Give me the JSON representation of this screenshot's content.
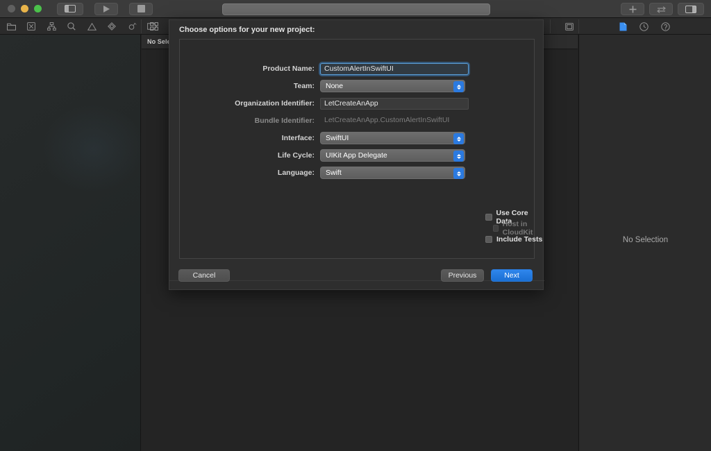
{
  "window": {
    "traffic_lights": [
      "close",
      "minimize",
      "zoom"
    ],
    "toolbar_left_buttons": [
      "toggle-navigator",
      "run",
      "stop"
    ],
    "toolbar_right_buttons": [
      "add-editor",
      "swap-editor",
      "toggle-inspector"
    ],
    "location_bar_value": ""
  },
  "navigator": {
    "tabs": [
      "folder-icon",
      "issue-icon",
      "test-icon",
      "search-icon",
      "warning-icon",
      "breakpoint-icon",
      "debug-icon",
      "tag-icon",
      "report-icon"
    ],
    "right_tabs": [
      "grid-icon",
      "chevron-left-icon"
    ]
  },
  "editor": {
    "jump_bar_label": "No Selec",
    "assistant_icon": "assistant-editor-icon"
  },
  "inspector": {
    "tabs": [
      "file-inspector-icon",
      "history-inspector-icon",
      "quick-help-icon"
    ],
    "active_tab": "file-inspector-icon",
    "empty_text": "No Selection",
    "accent": "#3b8ff0"
  },
  "sheet": {
    "title": "Choose options for your new project:",
    "fields": [
      {
        "label": "Product Name:",
        "value": "CustomAlertInSwiftUI",
        "type": "text",
        "state": "focused"
      },
      {
        "label": "Team:",
        "value": "None",
        "type": "popup",
        "state": "normal"
      },
      {
        "label": "Organization Identifier:",
        "value": "LetCreateAnApp",
        "type": "text",
        "state": "normal"
      },
      {
        "label": "Bundle Identifier:",
        "value": "LetCreateAnApp.CustomAlertInSwiftUI",
        "type": "readonly",
        "state": "disabled"
      },
      {
        "label": "Interface:",
        "value": "SwiftUI",
        "type": "popup",
        "state": "normal"
      },
      {
        "label": "Life Cycle:",
        "value": "UIKit App Delegate",
        "type": "popup",
        "state": "normal"
      },
      {
        "label": "Language:",
        "value": "Swift",
        "type": "popup",
        "state": "normal"
      }
    ],
    "checkboxes": [
      {
        "label": "Use Core Data",
        "checked": false,
        "disabled": false,
        "indent": false
      },
      {
        "label": "Host in CloudKit",
        "checked": false,
        "disabled": true,
        "indent": true
      },
      {
        "label": "Include Tests",
        "checked": false,
        "disabled": false,
        "indent": false
      }
    ],
    "buttons": {
      "cancel": "Cancel",
      "previous": "Previous",
      "next": "Next"
    }
  },
  "colors": {
    "accent_blue": "#2b7ae0",
    "primary_button": "#1f76de",
    "focus_ring": "#5d9fd6",
    "sheet_bg": "#2e2e2e",
    "window_bg": "#232323"
  }
}
